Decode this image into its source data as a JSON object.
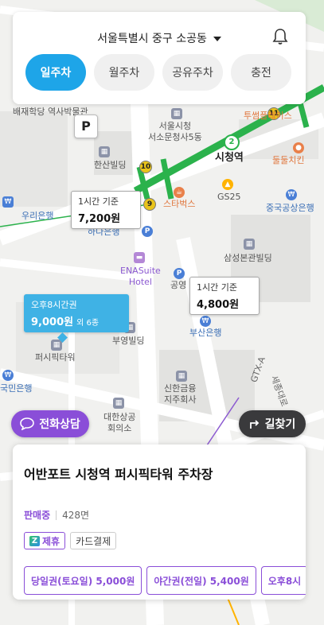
{
  "header": {
    "location": "서울특별시 중구 소공동",
    "tabs": [
      "일주차",
      "월주차",
      "공유주차",
      "충전"
    ],
    "active_tab": 0
  },
  "map": {
    "labels": {
      "baejae": "배재학당\n역사박물관",
      "hansan": "한산빌딩",
      "cityhall": "서울시청\n서소문청사5동",
      "cityhall_station": "시청역",
      "dulse": "둘둘치킨",
      "woori": "우리은행",
      "starbucks": "스타벅스",
      "gs25": "GS25",
      "china_bank": "중국공상은행",
      "samsung": "삼성본관빌딩",
      "hanabank": "하나은행",
      "ena": "ENASuite\nHotel",
      "gongyoung": "공영",
      "busan": "부산은행",
      "buyoung": "부영빌딩",
      "pacific": "퍼시픽타워",
      "kookmin": "국민은행",
      "shinhan": "신한금융\n지주회사",
      "daehan": "대한상공\n회의소",
      "gtx": "GTX-A",
      "sejong": "세종대로",
      "twosome": "투썸플레이스"
    },
    "line_badges": [
      "10",
      "11",
      "9",
      "2"
    ],
    "markers": [
      {
        "label": "1시간 기준",
        "price": "7,200원"
      },
      {
        "label": "1시간 기준",
        "price": "4,800원"
      },
      {
        "label": "오후8시간권",
        "price": "9,000원",
        "count": "외 6종"
      }
    ],
    "parking_marker": "P"
  },
  "buttons": {
    "consult": "전화상담",
    "route": "길찾기"
  },
  "lot": {
    "name": "어반포트 시청역 퍼시픽타워 주차장",
    "status": "판매중",
    "spaces": "428면",
    "badges": [
      "제휴",
      "카드결제"
    ],
    "tickets": [
      "당일권(토요일) 5,000원",
      "야간권(전일) 5,400원",
      "오후8시"
    ]
  },
  "colors": {
    "accent": "#1ea5e8",
    "purple": "#8a4ed8",
    "subway_green": "#2bb24c"
  }
}
